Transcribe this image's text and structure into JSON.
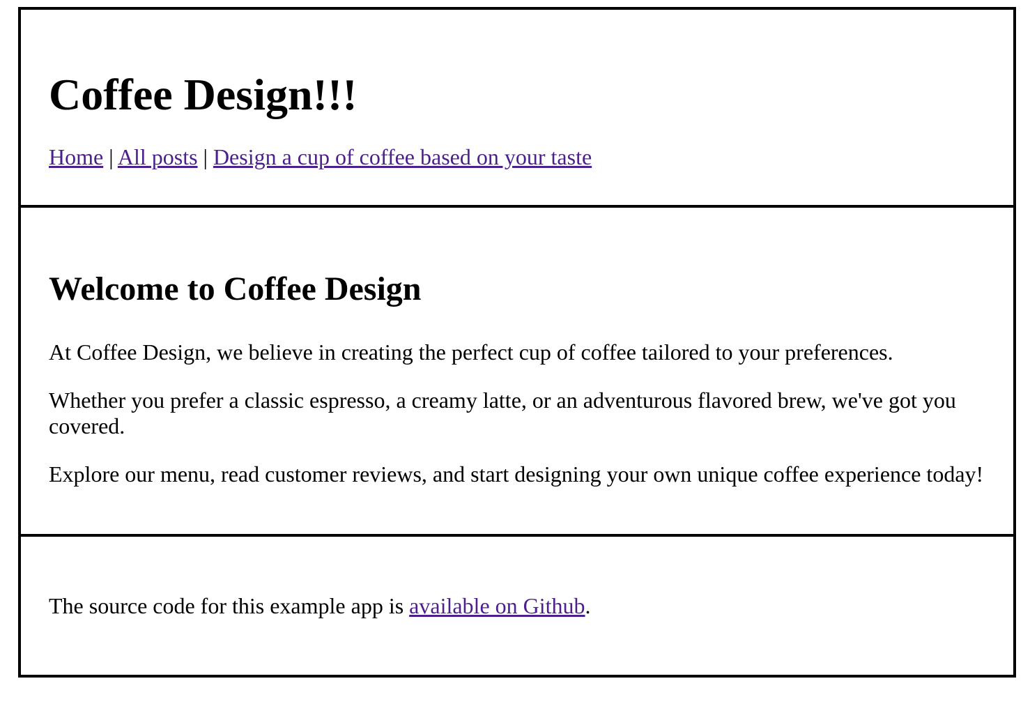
{
  "header": {
    "site_title": "Coffee Design!!!",
    "nav": {
      "home": "Home",
      "separator": "|",
      "all_posts": "All posts",
      "design": "Design a cup of coffee based on your taste"
    }
  },
  "main": {
    "heading": "Welcome to Coffee Design",
    "paragraphs": [
      "At Coffee Design, we believe in creating the perfect cup of coffee tailored to your preferences.",
      "Whether you prefer a classic espresso, a creamy latte, or an adventurous flavored brew, we've got you covered.",
      "Explore our menu, read customer reviews, and start designing your own unique coffee experience today!"
    ]
  },
  "footer": {
    "text_before": "The source code for this example app is ",
    "link_text": "available on Github",
    "text_after": "."
  },
  "colors": {
    "link": "#4b1f8c",
    "border": "#000000",
    "background": "#ffffff"
  }
}
